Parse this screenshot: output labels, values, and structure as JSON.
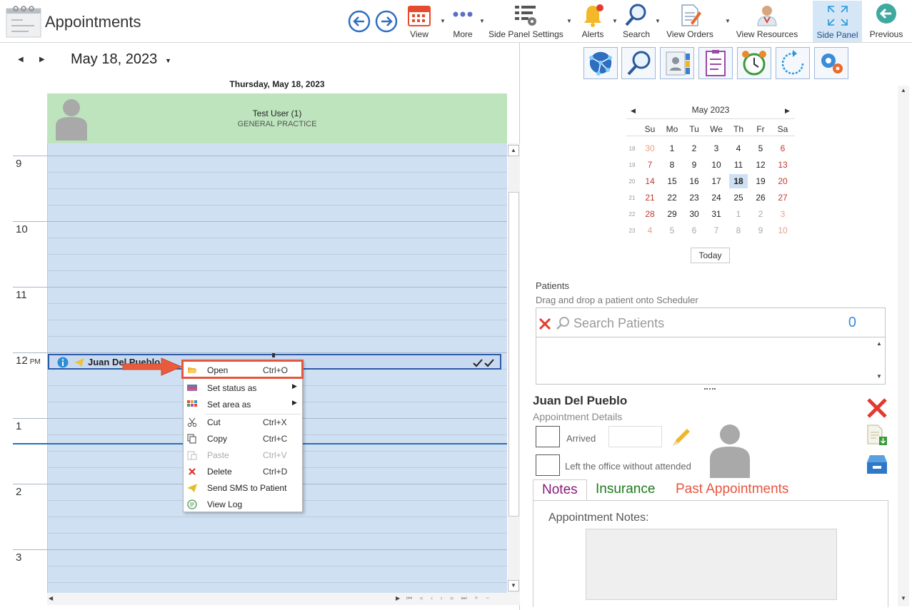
{
  "app": {
    "title": "Appointments"
  },
  "toolbar": {
    "items": [
      {
        "label": "View"
      },
      {
        "label": "More"
      },
      {
        "label": "Side Panel Settings"
      },
      {
        "label": "Alerts"
      },
      {
        "label": "Search"
      },
      {
        "label": "View Orders"
      },
      {
        "label": "View Resources"
      },
      {
        "label": "Side Panel"
      },
      {
        "label": "Previous"
      }
    ]
  },
  "scheduler": {
    "date": "May 18, 2023",
    "day_title": "Thursday, May 18, 2023",
    "resource_name": "Test User (1)",
    "resource_sub": "GENERAL PRACTICE",
    "hours": [
      "9",
      "10",
      "11",
      "12",
      "1",
      "2",
      "3"
    ],
    "pm_label": "PM",
    "appointment": {
      "patient": "Juan Del Pueblo"
    }
  },
  "context_menu": {
    "items": [
      {
        "label": "Open",
        "shortcut": "Ctrl+O"
      },
      {
        "label": "Set status as",
        "shortcut": ""
      },
      {
        "label": "Set area as",
        "shortcut": ""
      },
      {
        "label": "Cut",
        "shortcut": "Ctrl+X"
      },
      {
        "label": "Copy",
        "shortcut": "Ctrl+C"
      },
      {
        "label": "Paste",
        "shortcut": "Ctrl+V"
      },
      {
        "label": "Delete",
        "shortcut": "Ctrl+D"
      },
      {
        "label": "Send SMS to Patient",
        "shortcut": ""
      },
      {
        "label": "View Log",
        "shortcut": ""
      }
    ]
  },
  "mini_calendar": {
    "month": "May 2023",
    "dow": [
      "Su",
      "Mo",
      "Tu",
      "We",
      "Th",
      "Fr",
      "Sa"
    ],
    "weeks": [
      {
        "wk": "18",
        "days": [
          "30",
          "1",
          "2",
          "3",
          "4",
          "5",
          "6"
        ]
      },
      {
        "wk": "19",
        "days": [
          "7",
          "8",
          "9",
          "10",
          "11",
          "12",
          "13"
        ]
      },
      {
        "wk": "20",
        "days": [
          "14",
          "15",
          "16",
          "17",
          "18",
          "19",
          "20"
        ]
      },
      {
        "wk": "21",
        "days": [
          "21",
          "22",
          "23",
          "24",
          "25",
          "26",
          "27"
        ]
      },
      {
        "wk": "22",
        "days": [
          "28",
          "29",
          "30",
          "31",
          "1",
          "2",
          "3"
        ]
      },
      {
        "wk": "23",
        "days": [
          "4",
          "5",
          "6",
          "7",
          "8",
          "9",
          "10"
        ]
      }
    ],
    "selected": "18",
    "today_label": "Today"
  },
  "patients": {
    "title": "Patients",
    "subtitle": "Drag and drop a patient onto Scheduler",
    "search_placeholder": "Search Patients",
    "count": "0"
  },
  "details": {
    "name": "Juan Del Pueblo",
    "subtitle": "Appointment Details",
    "arrived_label": "Arrived",
    "left_label": "Left the office without attended"
  },
  "tabs": [
    {
      "label": "Notes",
      "color": "#8a1a7a"
    },
    {
      "label": "Insurance",
      "color": "#1d7a1d"
    },
    {
      "label": "Past Appointments",
      "color": "#e8553f"
    }
  ],
  "notes": {
    "label": "Appointment Notes:"
  },
  "colors": {
    "accent": "#2b5ca6",
    "weekend": "#c0392b",
    "highlight": "#e4573f"
  }
}
